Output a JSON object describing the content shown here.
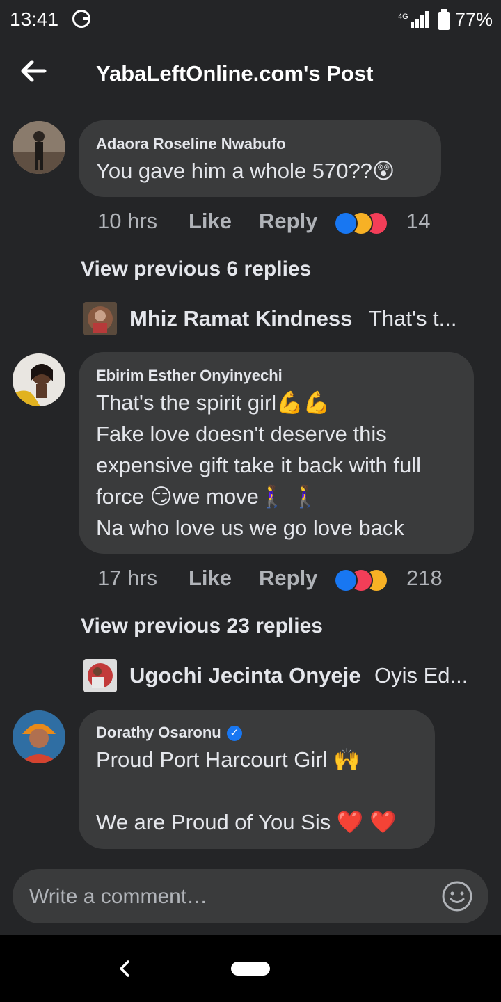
{
  "status_bar": {
    "time": "13:41",
    "network": "4G",
    "battery": "77%"
  },
  "header": {
    "title": "YabaLeftOnline.com's Post"
  },
  "comments": [
    {
      "author": "Adaora Roseline Nwabufo",
      "text": "You gave him a whole 570??😲",
      "time": "10 hrs",
      "like": "Like",
      "reply": "Reply",
      "reaction_count": "14",
      "reactions": [
        "like",
        "haha",
        "love"
      ],
      "view_previous": "View previous 6 replies",
      "latest_reply": {
        "name": "Mhiz Ramat Kindness",
        "text": "That's t..."
      }
    },
    {
      "author": "Ebirim Esther Onyinyechi",
      "text": "That's the spirit girl💪💪\nFake love doesn't deserve this\nexpensive gift take it back with full\nforce 😏we move🚶‍♀️ 🚶‍♀️\nNa who love us we go love back",
      "time": "17 hrs",
      "like": "Like",
      "reply": "Reply",
      "reaction_count": "218",
      "reactions": [
        "like",
        "love",
        "haha"
      ],
      "view_previous": "View previous 23 replies",
      "latest_reply": {
        "name": "Ugochi Jecinta Onyeje",
        "text": "Oyis Ed..."
      }
    },
    {
      "author": "Dorathy Osaronu",
      "verified": true,
      "text": "Proud Port Harcourt Girl 🙌\n\nWe are Proud of You Sis ❤️ ❤️"
    }
  ],
  "composer": {
    "placeholder": "Write a comment…"
  },
  "colors": {
    "background": "#242527",
    "bubble": "#3a3b3c",
    "like_blue": "#1877f2",
    "love_red": "#f33e58",
    "haha_yellow": "#f7b125"
  }
}
